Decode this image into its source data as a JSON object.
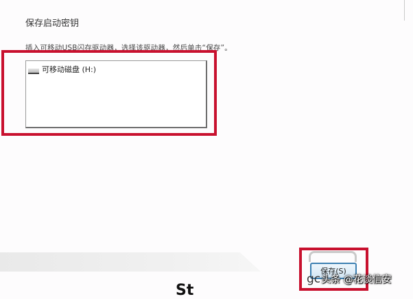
{
  "dialog": {
    "title": "保存启动密钥",
    "instruction": "插入可移动USB闪存驱动器，选择该驱动器，然后单击“保存”。"
  },
  "drives": [
    {
      "label": "可移动磁盘 (H:)",
      "icon": "usb-drive-icon"
    }
  ],
  "buttons": {
    "save_label": "保存(S)"
  },
  "watermark": {
    "prefix": "gc",
    "text": "头条 @花谈信安"
  },
  "footer_fragment": "St",
  "colors": {
    "highlight": "#c8102e",
    "button_border": "#3c7fb1",
    "background": "#fdfcfd"
  }
}
